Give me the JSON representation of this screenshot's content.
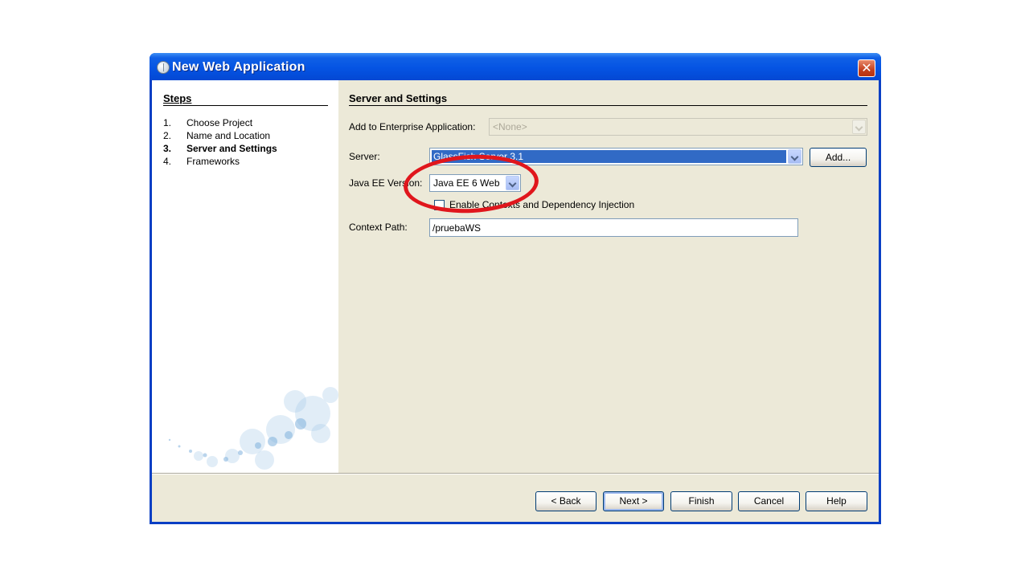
{
  "window": {
    "title": "New Web Application",
    "close_symbol": "✕"
  },
  "steps": {
    "title": "Steps",
    "items": [
      {
        "num": "1.",
        "label": "Choose Project"
      },
      {
        "num": "2.",
        "label": "Name and Location"
      },
      {
        "num": "3.",
        "label": "Server and Settings"
      },
      {
        "num": "4.",
        "label": "Frameworks"
      }
    ],
    "current_step": 3
  },
  "content": {
    "section_title": "Server and Settings",
    "enterprise_label": "Add to Enterprise Application:",
    "enterprise_value": "<None>",
    "server_label": "Server:",
    "server_value": "GlassFish Server 3.1",
    "add_button": "Add...",
    "javaee_label": "Java EE Version:",
    "javaee_value": "Java EE 6 Web",
    "cdi_checkbox_label": "Enable Contexts and Dependency Injection",
    "cdi_checked": false,
    "context_label": "Context Path:",
    "context_value": "/pruebaWS"
  },
  "buttons": {
    "back": "< Back",
    "next": "Next >",
    "finish": "Finish",
    "cancel": "Cancel",
    "help": "Help"
  },
  "colors": {
    "title_bar": "#0554e3",
    "dialog_bg": "#ece9d8",
    "selection": "#316ac5",
    "annotation_ring": "#e0161c"
  }
}
